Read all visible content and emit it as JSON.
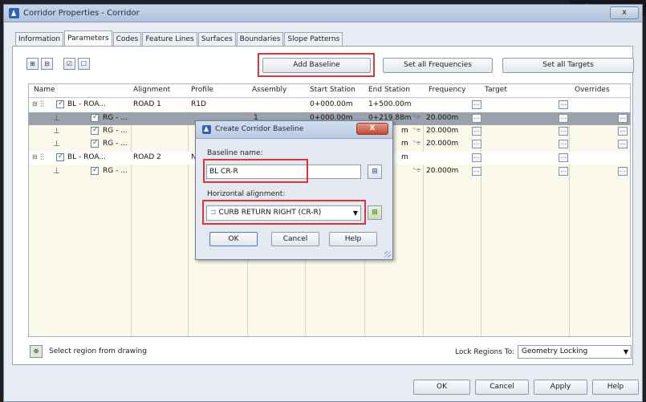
{
  "window": {
    "title": "Corridor Properties - Corridor",
    "close_label": "x"
  },
  "tabs": [
    {
      "label": "Information"
    },
    {
      "label": "Parameters"
    },
    {
      "label": "Codes"
    },
    {
      "label": "Feature Lines"
    },
    {
      "label": "Surfaces"
    },
    {
      "label": "Boundaries"
    },
    {
      "label": "Slope Patterns"
    }
  ],
  "toolbar": {
    "add_baseline": "Add Baseline",
    "set_all_frequencies": "Set all Frequencies",
    "set_all_targets": "Set all Targets"
  },
  "grid": {
    "columns": [
      "Name",
      "Alignment",
      "Profile",
      "Assembly",
      "Start Station",
      "End Station",
      "Frequency",
      "Target",
      "Overrides"
    ],
    "rows": [
      {
        "name": "BL - ROA...",
        "alignment": "ROAD 1",
        "profile": "R1D",
        "start": "0+000.00m",
        "end": "1+500.00m",
        "frequency": ""
      },
      {
        "name": "RG - ...",
        "assembly": "1",
        "start": "0+000.00m",
        "end": "0+219.88m",
        "frequency": "20.000m"
      },
      {
        "name": "RG - ...",
        "end": "m",
        "frequency": "20.000m"
      },
      {
        "name": "RG - ...",
        "end": "m",
        "frequency": "20.000m"
      },
      {
        "name": "BL - ROA...",
        "alignment": "ROAD 2",
        "profile": "N",
        "end": "m",
        "frequency": ""
      },
      {
        "name": "RG - ...",
        "end": "m",
        "frequency": "20.000m"
      }
    ]
  },
  "footer": {
    "select_region": "Select region from drawing",
    "lock_label": "Lock Regions To:",
    "lock_value": "Geometry Locking",
    "ok": "OK",
    "cancel": "Cancel",
    "apply": "Apply",
    "help": "Help"
  },
  "dialog": {
    "title": "Create Corridor Baseline",
    "close_label": "X",
    "baseline_name_label": "Baseline name:",
    "baseline_name_value": "BL CR-R",
    "horizontal_alignment_label": "Horizontal alignment:",
    "horizontal_alignment_value": "CURB RETURN RIGHT (CR-R)",
    "ok": "OK",
    "cancel": "Cancel",
    "help": "Help"
  },
  "colors": {
    "highlight_box": "#d8363b",
    "selected_row": "#9aa2ad",
    "grid_bg": "#fbf9ea"
  }
}
